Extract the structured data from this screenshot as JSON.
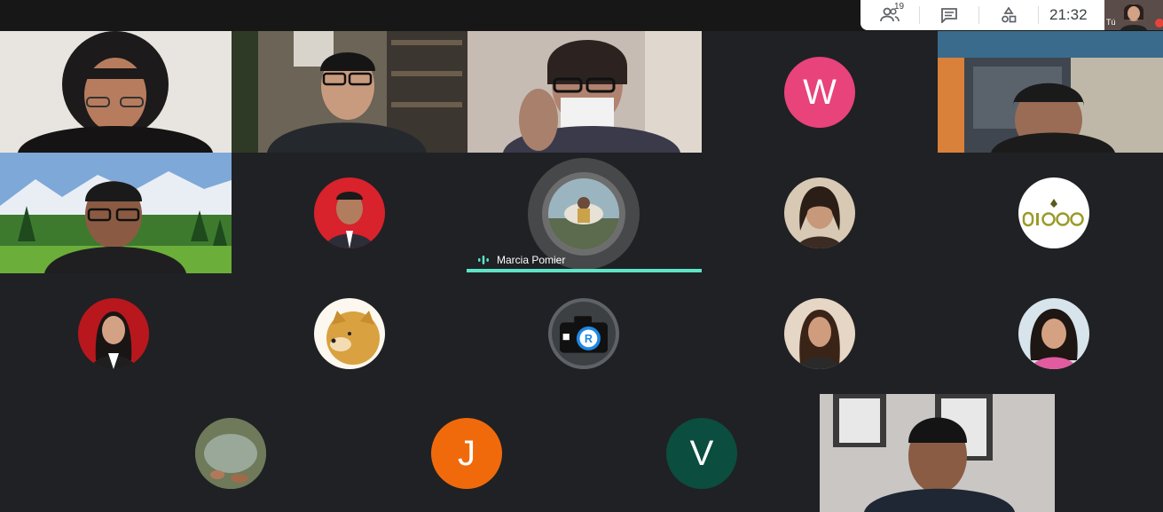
{
  "toolbar": {
    "participant_count": "19",
    "time": "21:32",
    "self_label": "Tú"
  },
  "speaker": {
    "name": "Marcia Pomier"
  },
  "letters": {
    "w": "W",
    "j": "J",
    "v": "V"
  },
  "colors": {
    "w_avatar": "#e8437a",
    "j_avatar": "#f06a0c",
    "v_avatar": "#0b4d3f",
    "speaking": "#5ee3c7"
  }
}
